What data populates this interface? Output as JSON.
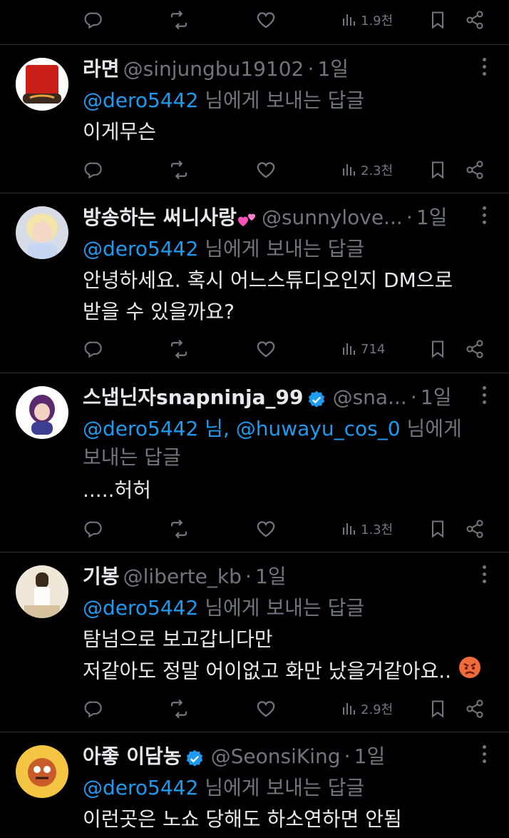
{
  "top_actions": {
    "views": "1.9천"
  },
  "tweets": [
    {
      "name": "라면",
      "handle": "@sinjungbu19102",
      "time": "1일",
      "reply_prefix": "",
      "mentions": "@dero5442",
      "reply_suffix": "님에게 보내는 답글",
      "lines": [
        "이게무슨"
      ],
      "views": "2.3천"
    },
    {
      "name": "방송하는 써니사랑",
      "handle": "@sunnylove...",
      "time": "1일",
      "mentions": "@dero5442",
      "reply_suffix": "님에게 보내는 답글",
      "lines": [
        "안녕하세요. 혹시 어느스튜디오인지 DM으로",
        "받을 수 있을까요?"
      ],
      "views": "714"
    },
    {
      "name": "스냅닌자snapninja_99",
      "handle": "@sna...",
      "time": "1일",
      "mentions": "@dero5442 님, @huwayu_cos_0",
      "reply_suffix": "님에게",
      "reply_line2": "보내는 답글",
      "lines": [
        ".....허허"
      ],
      "views": "1.3천"
    },
    {
      "name": "기봉",
      "handle": "@liberte_kb",
      "time": "1일",
      "mentions": "@dero5442",
      "reply_suffix": "님에게 보내는 답글",
      "lines": [
        "탐넘으로 보고갑니다만",
        "저같아도 정말 어이없고 화만 났을거같아요.."
      ],
      "views": "2.9천"
    },
    {
      "name": "아좋 이담농",
      "handle": "@SeonsiKing",
      "time": "1일",
      "mentions": "@dero5442",
      "reply_suffix": "님에게 보내는 답글",
      "lines": [
        "이런곳은 노쇼 당해도 하소연하면 안됨"
      ]
    }
  ],
  "separator_dot": "·",
  "colors": {
    "background": "#000000",
    "text": "#e7e9ea",
    "muted": "#71767b",
    "link": "#1d9bf0",
    "verified": "#1d9bf0"
  }
}
